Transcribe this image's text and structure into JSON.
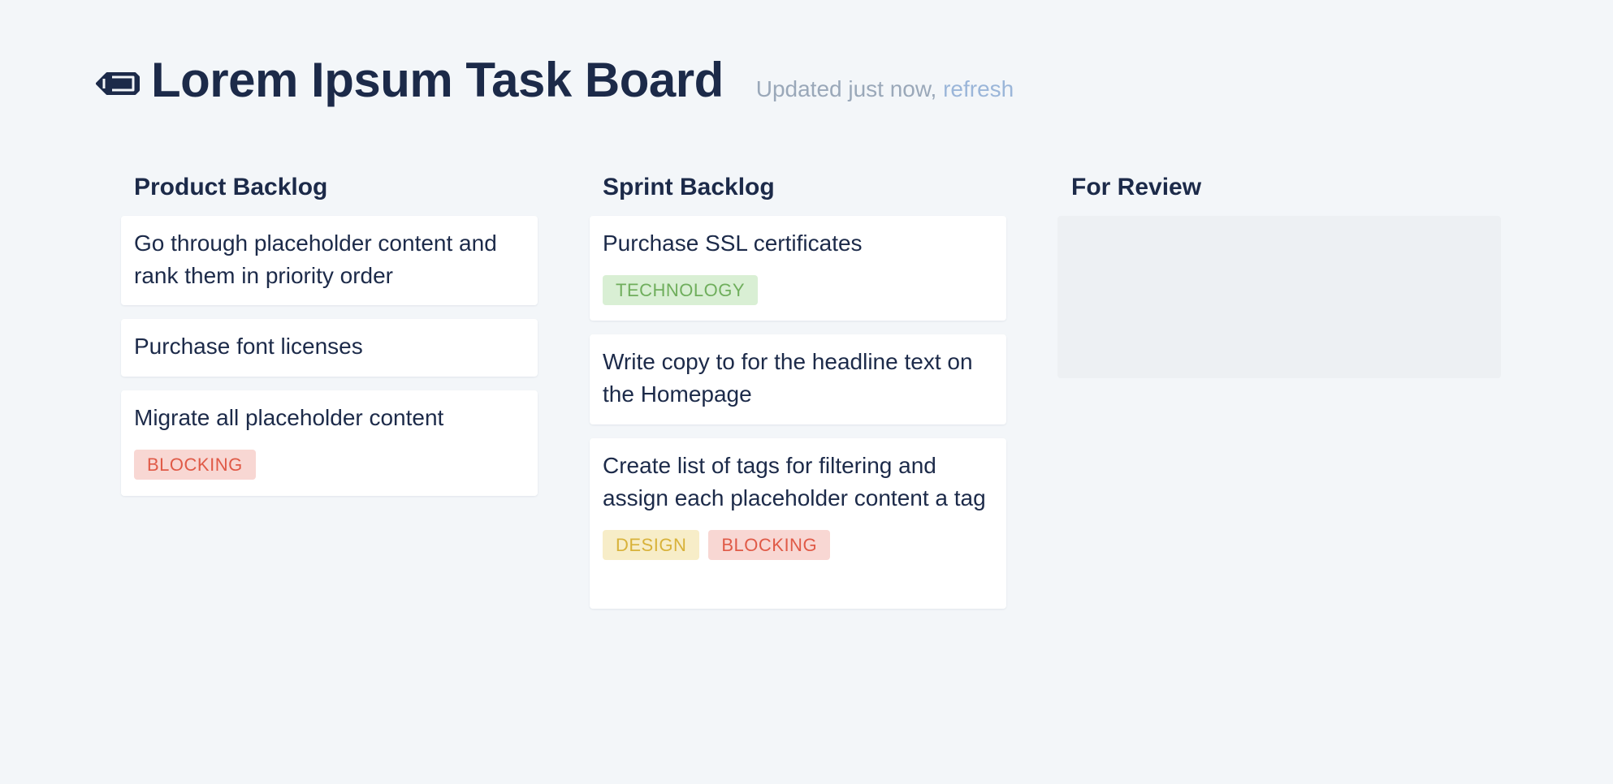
{
  "header": {
    "icon": "pencil-icon",
    "title": "Lorem Ipsum Task Board",
    "updated_text": "Updated just now, ",
    "refresh_label": "refresh"
  },
  "columns": [
    {
      "title": "Product Backlog",
      "cards": [
        {
          "text": "Go through placeholder content and rank them in priority order",
          "tags": []
        },
        {
          "text": "Purchase font licenses",
          "tags": []
        },
        {
          "text": "Migrate all placeholder content",
          "tags": [
            "BLOCKING"
          ]
        }
      ]
    },
    {
      "title": "Sprint Backlog",
      "cards": [
        {
          "text": "Purchase SSL certificates",
          "tags": [
            "TECHNOLOGY"
          ]
        },
        {
          "text": "Write copy to for the headline text on the Homepage",
          "tags": []
        },
        {
          "text": "Create list of tags for filtering and assign each placeholder content a tag",
          "tags": [
            "DESIGN",
            "BLOCKING"
          ]
        }
      ]
    },
    {
      "title": "For Review",
      "cards": []
    }
  ],
  "colors": {
    "background": "#f3f6f9",
    "text": "#1c2a49",
    "muted": "#9aa8b9",
    "link": "#9bb6d9",
    "blocking": "#e05a47",
    "technology": "#6fae5c",
    "design": "#d8b23a"
  }
}
